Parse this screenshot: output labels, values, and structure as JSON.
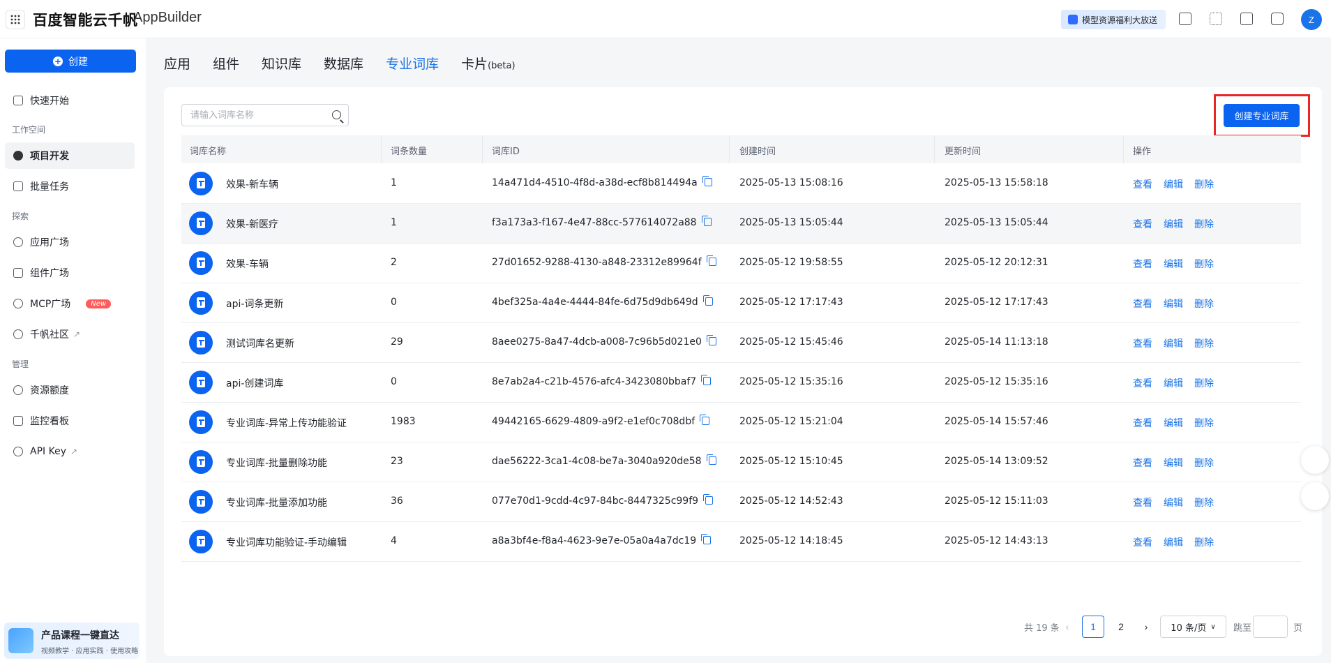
{
  "header": {
    "logo_cn": "百度智能云千帆",
    "logo_en": "AppBuilder",
    "promo": "模型资源福利大放送",
    "avatar": "Z",
    "icons": [
      "api-icon",
      "apps-icon",
      "book-icon",
      "message-icon"
    ]
  },
  "sidebar": {
    "create_label": "创建",
    "quick_start": "快速开始",
    "section_workspace": "工作空间",
    "project_dev": "项目开发",
    "batch_tasks": "批量任务",
    "section_explore": "探索",
    "app_plaza": "应用广场",
    "component_plaza": "组件广场",
    "mcp_plaza": "MCP广场",
    "new_badge": "New",
    "community": "千帆社区",
    "section_manage": "管理",
    "quota": "资源额度",
    "monitor": "监控看板",
    "api_key": "API Key",
    "course_title": "产品课程一键直达",
    "course_sub": "视频教学 · 应用实践 · 使用攻略"
  },
  "tabs": [
    {
      "label": "应用"
    },
    {
      "label": "组件"
    },
    {
      "label": "知识库"
    },
    {
      "label": "数据库"
    },
    {
      "label": "专业词库",
      "active": true
    },
    {
      "label": "卡片",
      "suffix": "(beta)"
    }
  ],
  "toolbar": {
    "search_placeholder": "请输入词库名称",
    "create_button": "创建专业词库"
  },
  "table": {
    "headers": [
      "词库名称",
      "词条数量",
      "词库ID",
      "创建时间",
      "更新时间",
      "操作"
    ],
    "actions": [
      "查看",
      "编辑",
      "删除"
    ],
    "rows": [
      {
        "name": "效果-新车辆",
        "count": "1",
        "id": "14a471d4-4510-4f8d-a38d-ecf8b814494a",
        "created": "2025-05-13 15:08:16",
        "updated": "2025-05-13 15:58:18"
      },
      {
        "name": "效果-新医疗",
        "count": "1",
        "id": "f3a173a3-f167-4e47-88cc-577614072a88",
        "created": "2025-05-13 15:05:44",
        "updated": "2025-05-13 15:05:44"
      },
      {
        "name": "效果-车辆",
        "count": "2",
        "id": "27d01652-9288-4130-a848-23312e89964f",
        "created": "2025-05-12 19:58:55",
        "updated": "2025-05-12 20:12:31"
      },
      {
        "name": "api-词条更新",
        "count": "0",
        "id": "4bef325a-4a4e-4444-84fe-6d75d9db649d",
        "created": "2025-05-12 17:17:43",
        "updated": "2025-05-12 17:17:43"
      },
      {
        "name": "测试词库名更新",
        "count": "29",
        "id": "8aee0275-8a47-4dcb-a008-7c96b5d021e0",
        "created": "2025-05-12 15:45:46",
        "updated": "2025-05-14 11:13:18"
      },
      {
        "name": "api-创建词库",
        "count": "0",
        "id": "8e7ab2a4-c21b-4576-afc4-3423080bbaf7",
        "created": "2025-05-12 15:35:16",
        "updated": "2025-05-12 15:35:16"
      },
      {
        "name": "专业词库-异常上传功能验证",
        "count": "1983",
        "id": "49442165-6629-4809-a9f2-e1ef0c708dbf",
        "created": "2025-05-12 15:21:04",
        "updated": "2025-05-14 15:57:46"
      },
      {
        "name": "专业词库-批量删除功能",
        "count": "23",
        "id": "dae56222-3ca1-4c08-be7a-3040a920de58",
        "created": "2025-05-12 15:10:45",
        "updated": "2025-05-14 13:09:52"
      },
      {
        "name": "专业词库-批量添加功能",
        "count": "36",
        "id": "077e70d1-9cdd-4c97-84bc-8447325c99f9",
        "created": "2025-05-12 14:52:43",
        "updated": "2025-05-12 15:11:03"
      },
      {
        "name": "专业词库功能验证-手动编辑",
        "count": "4",
        "id": "a8a3bf4e-f8a4-4623-9e7e-05a0a4a7dc19",
        "created": "2025-05-12 14:18:45",
        "updated": "2025-05-12 14:43:13"
      }
    ]
  },
  "pagination": {
    "total": "共 19 条",
    "pages": [
      "1",
      "2"
    ],
    "current": "1",
    "page_size": "10 条/页",
    "jump_label": "跳至",
    "page_suffix": "页"
  },
  "colors": {
    "accent": "#0a64f0",
    "highlight": "#e82626"
  }
}
